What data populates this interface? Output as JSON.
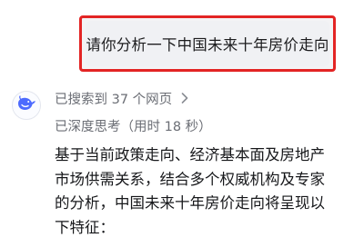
{
  "user_message": "请你分析一下中国未来十年房价走向",
  "assistant": {
    "search_status": "已搜索到 37 个网页",
    "thinking_status": "已深度思考（用时 18 秒）",
    "answer_lines": [
      "基于当前政策走向、经济基本面及房地产",
      "市场供需关系，结合多个权威机构及专家",
      "的分析，中国未来十年房价走向将呈现以",
      "下特征："
    ]
  },
  "colors": {
    "highlight_border": "#e32424",
    "bubble_bg": "#f0f1f4",
    "logo_blue": "#4d6bfe",
    "meta_text": "#6b6e75"
  },
  "icons": {
    "avatar": "whale-logo-icon",
    "expand": "chevron-right-icon"
  }
}
